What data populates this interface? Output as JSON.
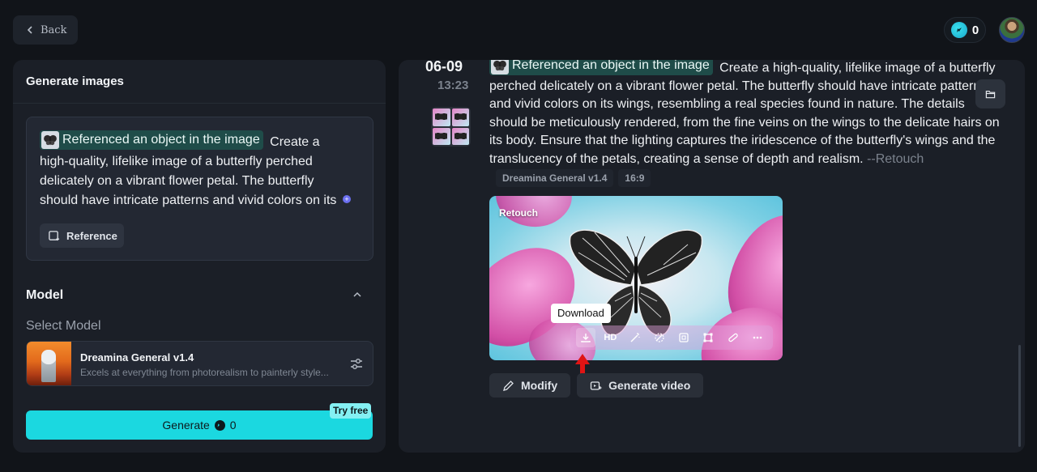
{
  "topbar": {
    "back_label": "Back",
    "credits": "0"
  },
  "left_panel": {
    "title": "Generate images",
    "prompt": {
      "reference_chip": "Referenced an object in the image",
      "text": "Create a high-quality, lifelike image of a butterfly perched delicately on a vibrant flower petal. The butterfly should have intricate patterns and vivid colors on its wings, resembling a real species found in nature. The details"
    },
    "reference_button": "Reference",
    "model_section_title": "Model",
    "select_model_label": "Select Model",
    "model": {
      "name": "Dreamina General v1.4",
      "description": "Excels at everything from photorealism to painterly style..."
    },
    "generate_button": {
      "label": "Generate",
      "cost": "0"
    },
    "try_free_badge": "Try free"
  },
  "right_panel": {
    "date": "06-09",
    "time": "13:23",
    "reference_chip": "Referenced an object in the image",
    "prompt": "Create a high-quality, lifelike image of a butterfly perched delicately on a vibrant flower petal. The butterfly should have intricate patterns and vivid colors on its wings, resembling a real species found in nature. The details should be meticulously rendered, from the fine veins on the wings to the delicate hairs on its body. Ensure that the lighting captures the iridescence of the butterfly's wings and the translucency of the petals, creating a sense of depth and realism.",
    "prompt_suffix": "--Retouch",
    "tags": [
      "Dreamina General v1.4",
      "16:9"
    ],
    "image_label": "Retouch",
    "toolbar": {
      "download_icon": "download-icon",
      "hd_label": "HD",
      "tools": [
        "magic-wand-icon",
        "eraser-icon",
        "expand-icon",
        "crop-icon",
        "brush-icon",
        "more-icon"
      ]
    },
    "tooltip": "Download",
    "actions": {
      "modify": "Modify",
      "generate_video": "Generate video"
    }
  },
  "colors": {
    "accent": "#1bd8e0",
    "background": "#111419",
    "panel": "#1b1f27",
    "chip": "#1f4c49",
    "arrow": "#e01414"
  }
}
